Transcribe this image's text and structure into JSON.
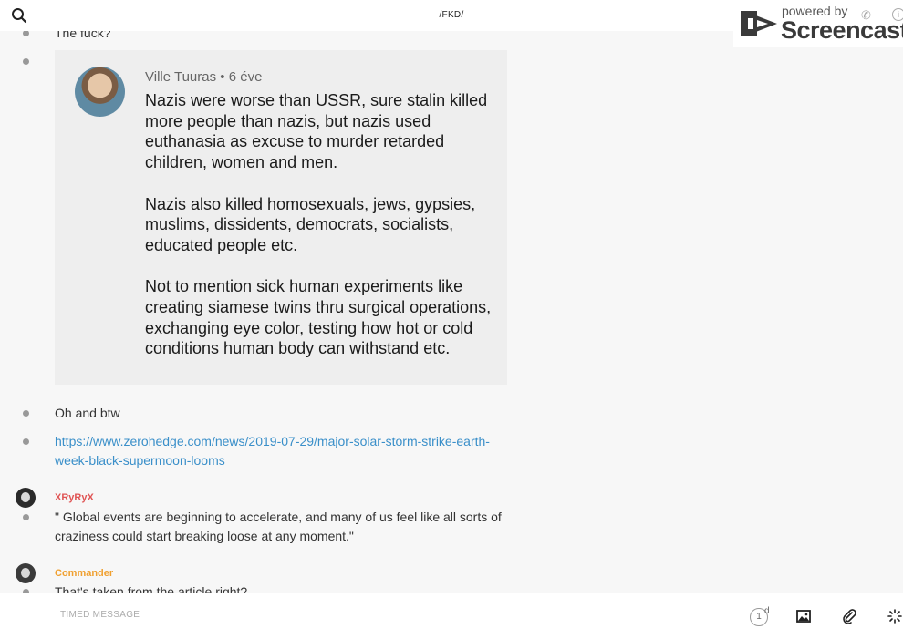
{
  "header": {
    "title": "/FKD/"
  },
  "watermark": {
    "powered_by": "powered by",
    "brand": "Screencastify"
  },
  "messages": {
    "m1": "The fuck?",
    "embed": {
      "author": "Ville Tuuras",
      "separator": "•",
      "time": "6 éve",
      "paragraphs": [
        "Nazis were worse than USSR, sure stalin killed more people than nazis, but nazis used euthanasia as excuse to murder retarded children, women and men.",
        "Nazis also killed homosexuals, jews, gypsies, muslims, dissidents, democrats, socialists, educated people etc.",
        "Not to mention sick human experiments like creating siamese twins thru surgical operations, exchanging eye color, testing how hot or cold conditions human body can withstand etc."
      ]
    },
    "m3": "Oh and btw",
    "m4_link": "https://www.zerohedge.com/news/2019-07-29/major-solar-storm-strike-earth-week-black-supermoon-looms",
    "u1": {
      "name": "XRyRyX",
      "color": "#e05555"
    },
    "m5": "\" Global events are beginning to accelerate, and many of us feel like all sorts of craziness could start breaking loose at any moment.\"",
    "u2": {
      "name": "Commander",
      "color": "#f0a030"
    },
    "m6": "That's taken from the article right?"
  },
  "composer": {
    "placeholder": "TIMED MESSAGE",
    "timer_value": "1",
    "timer_unit": "d"
  },
  "icons": [
    "search-icon",
    "phone-icon",
    "info-icon",
    "image-icon",
    "paperclip-icon",
    "loading-icon"
  ]
}
